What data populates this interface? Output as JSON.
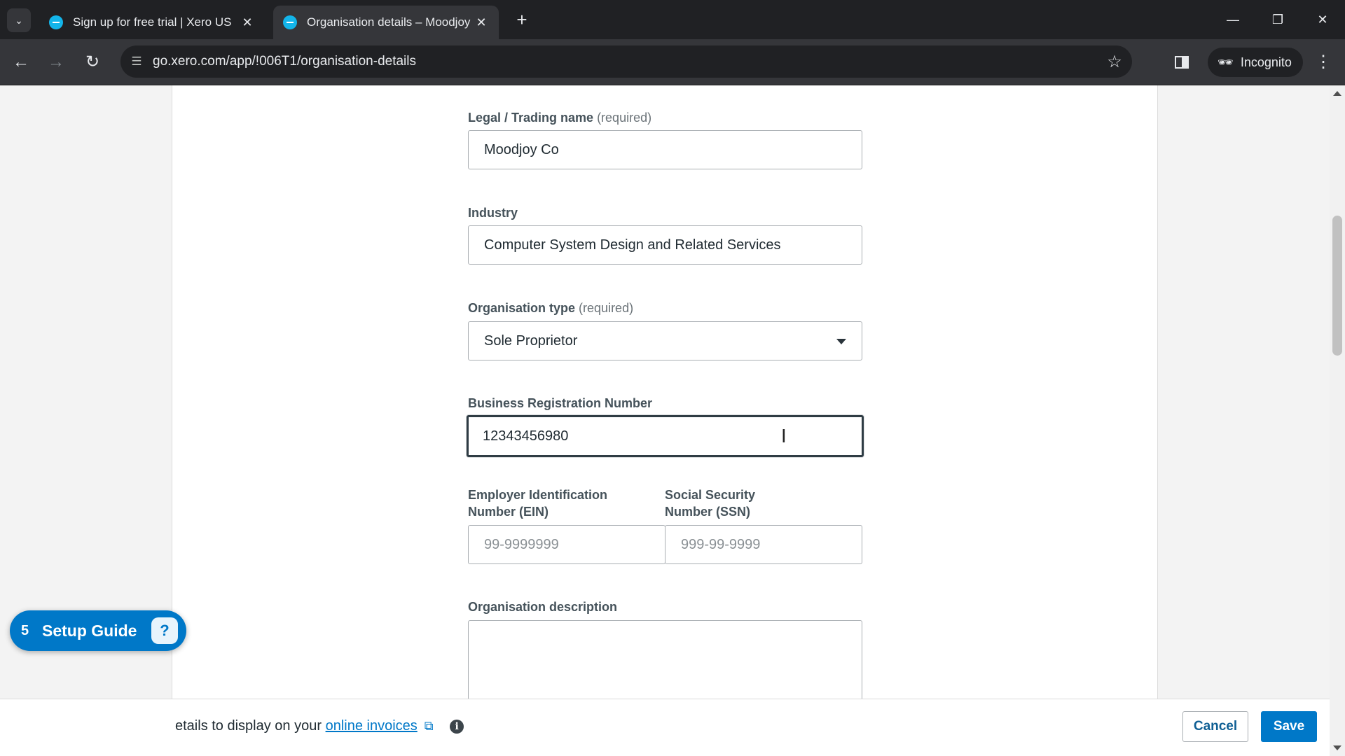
{
  "browser": {
    "tabs": [
      {
        "title": "Sign up for free trial | Xero US",
        "active": false
      },
      {
        "title": "Organisation details – Moodjoy",
        "active": true
      }
    ],
    "url": "go.xero.com/app/!006T1/organisation-details",
    "profile_label": "Incognito"
  },
  "form": {
    "legal_name": {
      "label": "Legal / Trading name",
      "required_label": "(required)",
      "value": "Moodjoy Co"
    },
    "industry": {
      "label": "Industry",
      "value": "Computer System Design and Related Services"
    },
    "org_type": {
      "label": "Organisation type",
      "required_label": "(required)",
      "value": "Sole Proprietor"
    },
    "brn": {
      "label": "Business Registration Number",
      "value": "12343456980"
    },
    "ein": {
      "label_line1": "Employer Identification",
      "label_line2": "Number (EIN)",
      "placeholder": "99-9999999"
    },
    "ssn": {
      "label_line1": "Social Security",
      "label_line2": "Number (SSN)",
      "placeholder": "999-99-9999"
    },
    "description": {
      "label": "Organisation description",
      "value": ""
    }
  },
  "footer": {
    "text_prefix": "etails to display on your",
    "link_label": "online invoices",
    "cancel_label": "Cancel",
    "save_label": "Save"
  },
  "setup_guide": {
    "count": "5",
    "label": "Setup Guide"
  },
  "colors": {
    "brand_blue": "#0078c8",
    "label_text": "#45525a",
    "chrome_dark": "#202124"
  }
}
